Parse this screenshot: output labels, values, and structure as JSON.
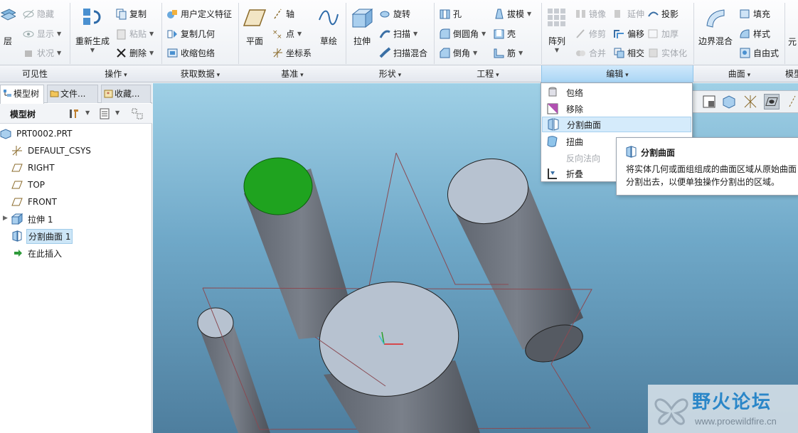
{
  "ribbon": {
    "visibility": {
      "layers": "层",
      "hide": "隐藏",
      "show": "显示",
      "status": "状况",
      "group": "可见性"
    },
    "operations": {
      "regenerate": "重新生成",
      "copy": "复制",
      "paste": "粘贴",
      "delete": "删除",
      "group": "操作"
    },
    "get_data": {
      "udf": "用户定义特征",
      "copy_geom": "复制几何",
      "shrinkwrap": "收缩包络",
      "group": "获取数据"
    },
    "datum": {
      "plane": "平面",
      "axis": "轴",
      "point": "点",
      "csys": "坐标系",
      "sketch": "草绘",
      "group": "基准"
    },
    "shapes": {
      "extrude": "拉伸",
      "revolve": "旋转",
      "sweep": "扫描",
      "swept_blend": "扫描混合",
      "group": "形状"
    },
    "engineering": {
      "hole": "孔",
      "round": "倒圆角",
      "chamfer": "倒角",
      "draft": "拔模",
      "shell": "壳",
      "rib": "筋",
      "group": "工程"
    },
    "editing": {
      "pattern": "阵列",
      "mirror": "镜像",
      "trim": "修剪",
      "merge": "合并",
      "extend": "延伸",
      "offset": "偏移",
      "intersect": "相交",
      "project": "投影",
      "thicken": "加厚",
      "solidify": "实体化",
      "group": "编辑"
    },
    "surfaces": {
      "boundary_blend": "边界混合",
      "fill": "填充",
      "style": "样式",
      "freestyle": "自由式",
      "group": "曲面"
    },
    "model": {
      "cut_label": "元",
      "group_cut": "模型"
    }
  },
  "panel": {
    "tabs": [
      "模型树",
      "文件...",
      "收藏..."
    ],
    "title": "模型树",
    "tree": [
      "PRT0002.PRT",
      "DEFAULT_CSYS",
      "RIGHT",
      "TOP",
      "FRONT",
      "拉伸 1",
      "分割曲面 1",
      "在此插入"
    ]
  },
  "menu": {
    "items": [
      "包络",
      "移除",
      "分割曲面",
      "扭曲",
      "反向法向",
      "折叠"
    ]
  },
  "tooltip": {
    "title": "分割曲面",
    "body": "将实体几何或面组组成的曲面区域从原始曲面分割出去，以便单独操作分割出的区域。"
  },
  "watermark": {
    "text": "野火论坛",
    "url": "www.proewildfire.cn"
  },
  "colors": {
    "accent": "#a9d5f5",
    "selected_face": "#1fa31f",
    "viewport_top": "#9fd0e6",
    "viewport_bottom": "#4e7e9e"
  }
}
